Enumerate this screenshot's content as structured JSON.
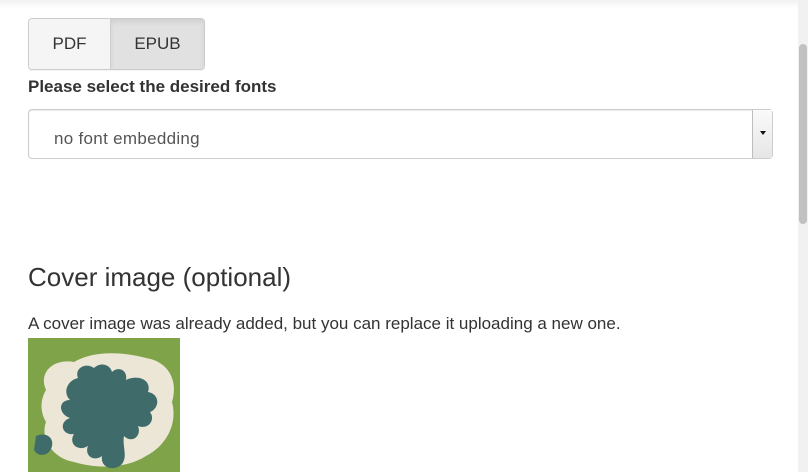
{
  "format_tabs": [
    {
      "label": "PDF",
      "active": false
    },
    {
      "label": "EPUB",
      "active": true
    }
  ],
  "fonts": {
    "label": "Please select the desired fonts",
    "selected": "no font embedding"
  },
  "cover": {
    "heading": "Cover image (optional)",
    "description": "A cover image was already added, but you can replace it uploading a new one."
  },
  "colors": {
    "cover_background": "#7fa348",
    "cover_blob_light": "#ece6d7",
    "cover_blob_dark": "#3f6c6a"
  }
}
